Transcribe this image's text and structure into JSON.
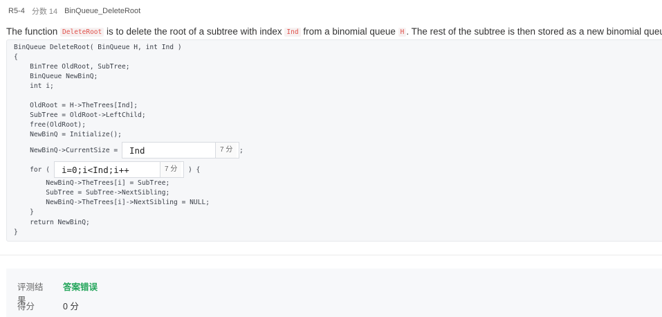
{
  "header": {
    "problem_id": "R5-4",
    "score_label": "分数 14",
    "problem_title": "BinQueue_DeleteRoot"
  },
  "description": {
    "t1": "The function ",
    "c1": "DeleteRoot",
    "t2": " is to delete the root of a subtree with index ",
    "c2": "Ind",
    "t3": " from a binomial queue ",
    "c3": "H",
    "t4": ". The rest of the subtree is then stored as a new binomial queue a"
  },
  "code": {
    "l1": "BinQueue DeleteRoot( BinQueue H, int Ind )",
    "l2": "{",
    "l3": "    BinTree OldRoot, SubTree;",
    "l4": "    BinQueue NewBinQ;",
    "l5": "    int i;",
    "l6": "    OldRoot = H->TheTrees[Ind];",
    "l7": "    SubTree = OldRoot->LeftChild;",
    "l8": "    free(OldRoot);",
    "l9": "    NewBinQ = Initialize();",
    "l10_pre": "    NewBinQ->CurrentSize = ",
    "l10_post": ";",
    "l11_pre": "    for (",
    "l11_post": ") {",
    "l12": "        NewBinQ->TheTrees[i] = SubTree;",
    "l13": "        SubTree = SubTree->NextSibling;",
    "l14": "        NewBinQ->TheTrees[i]->NextSibling = NULL;",
    "l15": "    }",
    "l16": "    return NewBinQ;",
    "l17": "}"
  },
  "blanks": [
    {
      "value": "Ind",
      "score": "7 分"
    },
    {
      "value": "i=0;i<Ind;i++",
      "score": "7 分"
    }
  ],
  "results": {
    "judge_label": "评测结果",
    "judge_value": "答案错误",
    "score_label": "得分",
    "score_value": "0 分"
  },
  "colors": {
    "wrong_answer": "#23a55a",
    "inline_code": "#e0514b"
  }
}
